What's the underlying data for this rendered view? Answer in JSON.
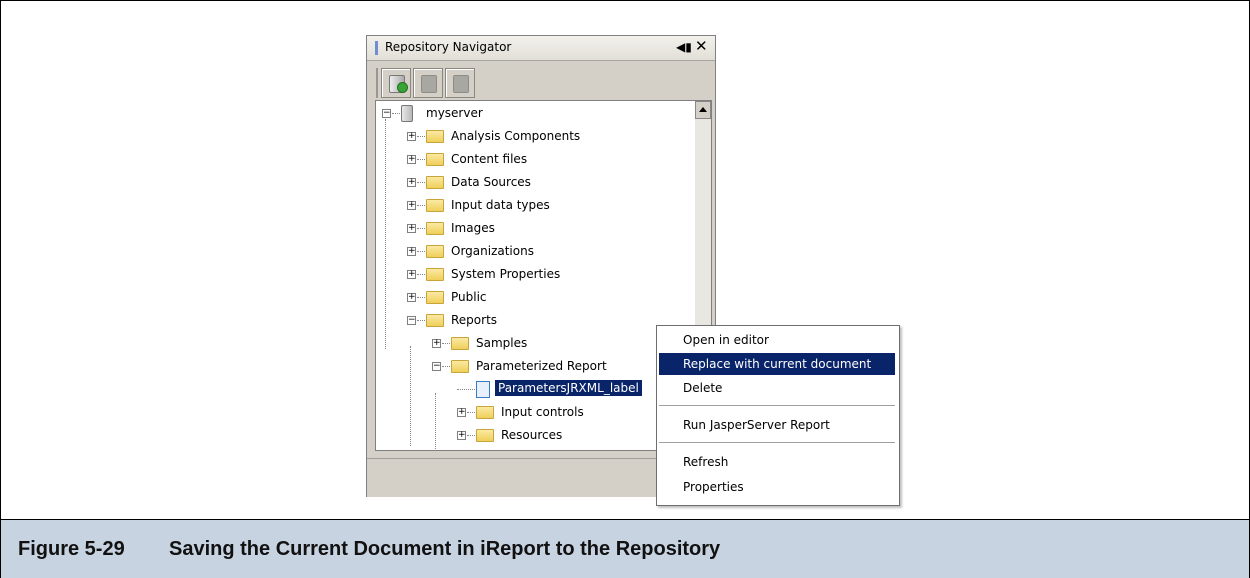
{
  "figure": {
    "number": "Figure 5-29",
    "caption": "Saving the Current Document in iReport to the Repository"
  },
  "navigator": {
    "title": "Repository Navigator",
    "pin_icon": "◀▮",
    "close_icon": "✕"
  },
  "toolbar": {
    "buttons": [
      {
        "icon": "add-server-icon",
        "enabled": true
      },
      {
        "icon": "edit-server-icon",
        "enabled": false
      },
      {
        "icon": "remove-server-icon",
        "enabled": false
      }
    ]
  },
  "tree": {
    "root": {
      "label": "myserver",
      "expander": "−"
    },
    "top_folders": [
      {
        "label": "Analysis Components",
        "expander": "+"
      },
      {
        "label": "Content files",
        "expander": "+"
      },
      {
        "label": "Data Sources",
        "expander": "+"
      },
      {
        "label": "Input data types",
        "expander": "+"
      },
      {
        "label": "Images",
        "expander": "+"
      },
      {
        "label": "Organizations",
        "expander": "+"
      },
      {
        "label": "System Properties",
        "expander": "+"
      },
      {
        "label": "Public",
        "expander": "+"
      },
      {
        "label": "Reports",
        "expander": "−"
      }
    ],
    "reports_children": [
      {
        "label": "Samples",
        "expander": "+"
      },
      {
        "label": "Parameterized Report",
        "expander": "−"
      }
    ],
    "selected_item": "ParametersJRXML_label",
    "param_children": [
      {
        "label": "Input controls",
        "expander": "+"
      },
      {
        "label": "Resources",
        "expander": "+"
      }
    ]
  },
  "context_menu": {
    "items": [
      {
        "label": "Open in editor"
      },
      {
        "label": "Replace with current document",
        "active": true
      },
      {
        "label": "Delete"
      },
      {
        "label": "Run JasperServer Report"
      },
      {
        "label": "Refresh"
      },
      {
        "label": "Properties"
      }
    ]
  },
  "colors": {
    "selection": "#0a246a",
    "caption_bg": "#c8d3e2",
    "panel_bg": "#d4d0c8",
    "folder": "#f0cf5a"
  }
}
